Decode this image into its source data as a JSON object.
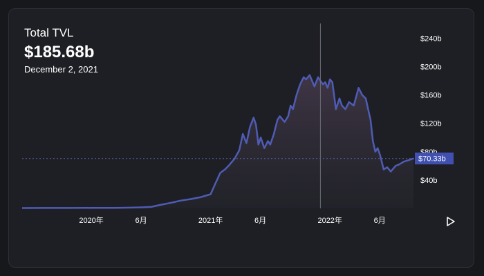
{
  "header": {
    "title": "Total TVL",
    "value": "$185.68b",
    "date": "December 2, 2021"
  },
  "current_label": "$70.33b",
  "colors": {
    "background": "#17181c",
    "card": "#1e1f24",
    "line": "#4f5cb4",
    "accent_label": "#4050b0",
    "crosshair": "#6b6e76"
  },
  "controls": {
    "play_icon": "play-icon"
  },
  "chart_data": {
    "type": "area",
    "title": "Total TVL",
    "xlabel": "",
    "ylabel": "",
    "x_ticks": [
      {
        "t": 2020.0,
        "label": "2020年"
      },
      {
        "t": 2020.417,
        "label": "6月"
      },
      {
        "t": 2021.0,
        "label": "2021年"
      },
      {
        "t": 2021.417,
        "label": "6月"
      },
      {
        "t": 2022.0,
        "label": "2022年"
      },
      {
        "t": 2022.417,
        "label": "6月"
      }
    ],
    "y_ticks": [
      {
        "v": 40,
        "label": "$40b"
      },
      {
        "v": 80,
        "label": "$80b"
      },
      {
        "v": 120,
        "label": "$120b"
      },
      {
        "v": 160,
        "label": "$160b"
      },
      {
        "v": 200,
        "label": "$200b"
      },
      {
        "v": 240,
        "label": "$240b"
      }
    ],
    "ylim": [
      0,
      255
    ],
    "xlim": [
      2019.42,
      2022.7
    ],
    "grid": false,
    "crosshair_t": 2021.92,
    "current_value": 70.33,
    "series": [
      {
        "x": [
          2019.42,
          2019.6,
          2019.8,
          2020.0,
          2020.2,
          2020.3,
          2020.42,
          2020.5,
          2020.58,
          2020.67,
          2020.75,
          2020.83,
          2020.92,
          2021.0,
          2021.04,
          2021.08,
          2021.12,
          2021.15,
          2021.2,
          2021.24,
          2021.27,
          2021.3,
          2021.33,
          2021.36,
          2021.38,
          2021.4,
          2021.42,
          2021.45,
          2021.48,
          2021.5,
          2021.53,
          2021.56,
          2021.58,
          2021.62,
          2021.65,
          2021.67,
          2021.69,
          2021.72,
          2021.75,
          2021.78,
          2021.8,
          2021.83,
          2021.85,
          2021.87,
          2021.9,
          2021.92,
          2021.94,
          2021.96,
          2021.98,
          2022.0,
          2022.02,
          2022.05,
          2022.08,
          2022.1,
          2022.13,
          2022.16,
          2022.2,
          2022.24,
          2022.27,
          2022.3,
          2022.32,
          2022.34,
          2022.36,
          2022.38,
          2022.4,
          2022.42,
          2022.45,
          2022.48,
          2022.51,
          2022.55,
          2022.58,
          2022.62,
          2022.66,
          2022.7
        ],
        "y": [
          0.5,
          0.6,
          0.6,
          0.7,
          0.8,
          1.0,
          1.5,
          2.0,
          5.0,
          8.0,
          11,
          13,
          16,
          20,
          35,
          50,
          55,
          60,
          70,
          82,
          105,
          92,
          115,
          128,
          118,
          90,
          100,
          85,
          95,
          90,
          105,
          125,
          130,
          122,
          130,
          145,
          140,
          160,
          175,
          185,
          182,
          188,
          180,
          172,
          185,
          180,
          175,
          178,
          170,
          182,
          178,
          140,
          155,
          145,
          140,
          150,
          145,
          170,
          160,
          155,
          140,
          125,
          95,
          80,
          85,
          75,
          55,
          58,
          52,
          60,
          62,
          66,
          68,
          70.33
        ]
      }
    ]
  }
}
